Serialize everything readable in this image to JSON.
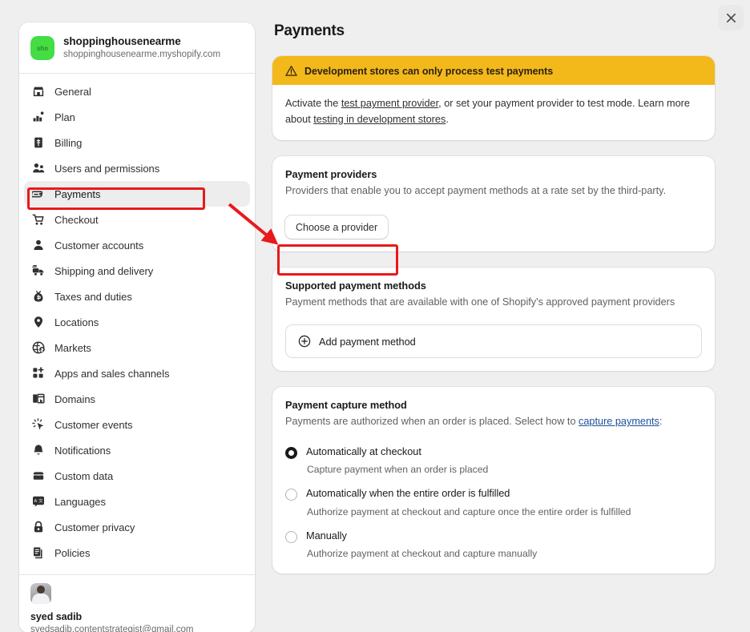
{
  "window": {
    "close_label": "×",
    "background_color": "#efefef"
  },
  "sidebar": {
    "store": {
      "avatar_text": "sho",
      "avatar_color": "#44dd44",
      "name": "shoppinghousenearme",
      "domain": "shoppinghousenearme.myshopify.com"
    },
    "items": [
      {
        "label": "General",
        "icon": "store-icon",
        "active": false
      },
      {
        "label": "Plan",
        "icon": "chart-plan-icon",
        "active": false
      },
      {
        "label": "Billing",
        "icon": "billing-receipt-icon",
        "active": false
      },
      {
        "label": "Users and permissions",
        "icon": "users-icon",
        "active": false
      },
      {
        "label": "Payments",
        "icon": "payment-card-icon",
        "active": true
      },
      {
        "label": "Checkout",
        "icon": "cart-icon",
        "active": false
      },
      {
        "label": "Customer accounts",
        "icon": "person-icon",
        "active": false
      },
      {
        "label": "Shipping and delivery",
        "icon": "truck-icon",
        "active": false
      },
      {
        "label": "Taxes and duties",
        "icon": "money-bag-icon",
        "active": false
      },
      {
        "label": "Locations",
        "icon": "map-pin-icon",
        "active": false
      },
      {
        "label": "Markets",
        "icon": "globe-icon",
        "active": false
      },
      {
        "label": "Apps and sales channels",
        "icon": "apps-grid-plus-icon",
        "active": false
      },
      {
        "label": "Domains",
        "icon": "domain-window-icon",
        "active": false
      },
      {
        "label": "Customer events",
        "icon": "click-cursor-icon",
        "active": false
      },
      {
        "label": "Notifications",
        "icon": "bell-icon",
        "active": false
      },
      {
        "label": "Custom data",
        "icon": "database-icon",
        "active": false
      },
      {
        "label": "Languages",
        "icon": "translate-icon",
        "active": false
      },
      {
        "label": "Customer privacy",
        "icon": "lock-icon",
        "active": false
      },
      {
        "label": "Policies",
        "icon": "policy-document-icon",
        "active": false
      }
    ],
    "user": {
      "name": "syed sadib",
      "email": "syedsadib.contentstrategist@gmail.com"
    }
  },
  "main": {
    "page_title": "Payments",
    "banner": {
      "icon": "warning-triangle-icon",
      "title": "Development stores can only process test payments",
      "body_prefix": "Activate the ",
      "link1": "test payment provider",
      "body_middle": ", or set your payment provider to test mode. Learn more about ",
      "link2": "testing in development stores",
      "body_suffix": ".",
      "background_color": "#f3b81a"
    },
    "payment_providers": {
      "title": "Payment providers",
      "description": "Providers that enable you to accept payment methods at a rate set by the third-party.",
      "button_label": "Choose a provider"
    },
    "supported_methods": {
      "title": "Supported payment methods",
      "description": "Payment methods that are available with one of Shopify's approved payment providers",
      "add_button_label": "Add payment method",
      "add_button_icon": "plus-circle-icon"
    },
    "capture_method": {
      "title": "Payment capture method",
      "description_prefix": "Payments are authorized when an order is placed. Select how to ",
      "description_link": "capture payments",
      "description_suffix": ":",
      "options": [
        {
          "label": "Automatically at checkout",
          "help": "Capture payment when an order is placed",
          "selected": true
        },
        {
          "label": "Automatically when the entire order is fulfilled",
          "help": "Authorize payment at checkout and capture once the entire order is fulfilled",
          "selected": false
        },
        {
          "label": "Manually",
          "help": "Authorize payment at checkout and capture manually",
          "selected": false
        }
      ]
    }
  },
  "annotations": {
    "color": "#e8191b",
    "highlight_payments_nav": true,
    "highlight_choose_provider_button": true,
    "arrow_from_nav_to_button": true
  }
}
